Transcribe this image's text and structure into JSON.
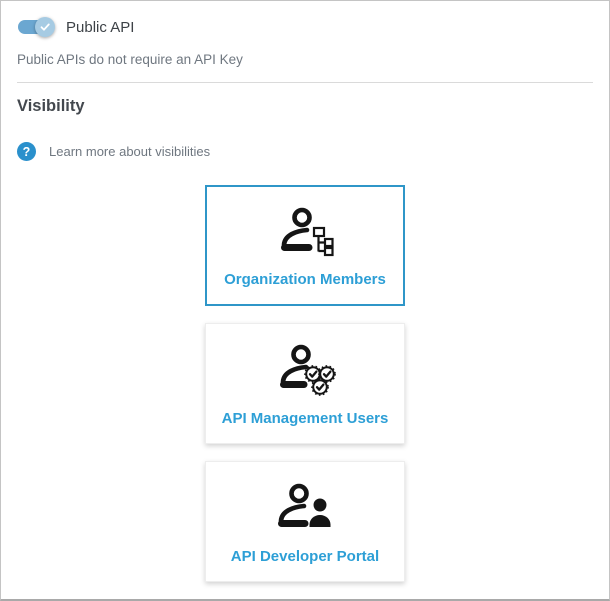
{
  "public_api": {
    "label": "Public API",
    "state": "on",
    "helper": "Public APIs do not require an API Key"
  },
  "visibility": {
    "heading": "Visibility",
    "learn_more": "Learn more about visibilities"
  },
  "cards": [
    {
      "label": "Organization Members",
      "icon": "person-org-chart-icon",
      "selected": true
    },
    {
      "label": "API Management Users",
      "icon": "person-gears-icon",
      "selected": false
    },
    {
      "label": "API Developer Portal",
      "icon": "people-icon",
      "selected": false
    }
  ],
  "colors": {
    "accent_border_blue": "#2f96c8",
    "card_label_blue": "#2d9fd6",
    "toggle_track_blue": "#6ba7d1",
    "toggle_thumb_blue": "#a6cbe3",
    "help_icon_blue": "#2a90cc",
    "icon_black": "#151515"
  }
}
